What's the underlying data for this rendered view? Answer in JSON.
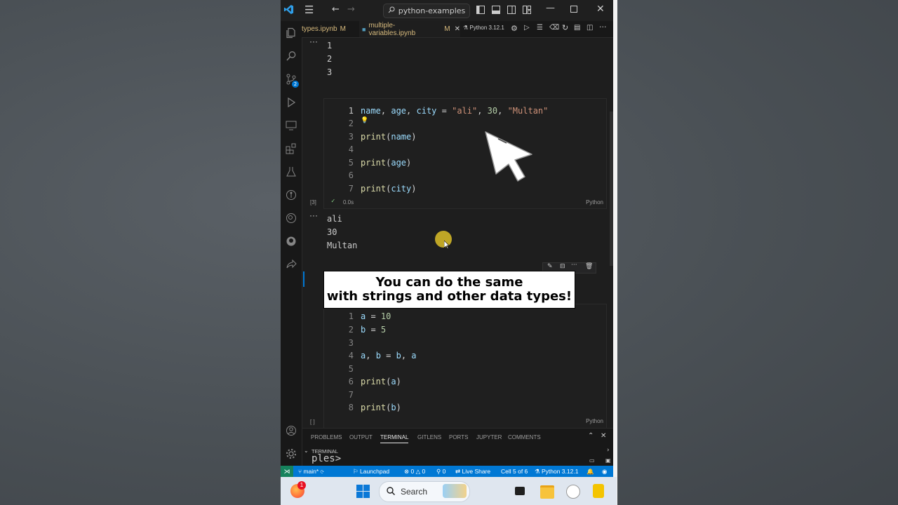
{
  "window": {
    "search_text": "python-examples"
  },
  "tabs": [
    {
      "label": "types.ipynb",
      "modified": "M"
    },
    {
      "label": "multiple-variables.ipynb",
      "modified": "M",
      "close": "✕"
    }
  ],
  "kernel": {
    "label": "Python 3.12.1"
  },
  "activity_bar": {
    "scm_badge": "2"
  },
  "output1": {
    "lines": [
      "1",
      "2",
      "3"
    ]
  },
  "cell1": {
    "line_numbers": [
      "1",
      "2",
      "3",
      "4",
      "5",
      "6",
      "7"
    ],
    "exec_count": "[3]",
    "exec_time": "0.0s",
    "language": "Python"
  },
  "output2": {
    "lines": [
      "ali",
      "30",
      "Multan"
    ]
  },
  "cell2": {
    "line_numbers": [
      "1",
      "2",
      "3",
      "4",
      "5",
      "6",
      "7",
      "8"
    ],
    "exec_count": "[ ]",
    "language": "Python"
  },
  "overlay_caption": {
    "line1": "You can do the same",
    "line2": "with strings and other data types!"
  },
  "panel": {
    "tabs": [
      "PROBLEMS",
      "OUTPUT",
      "TERMINAL",
      "GITLENS",
      "PORTS",
      "JUPYTER",
      "COMMENTS"
    ],
    "section": "TERMINAL",
    "terminal_text": "ples>"
  },
  "statusbar": {
    "branch": "main*",
    "launchpad": "Launchpad",
    "errors": "0",
    "warnings": "0",
    "ports": "0",
    "live_share": "Live Share",
    "cell": "Cell 5 of 6",
    "python": "Python 3.12.1"
  },
  "taskbar": {
    "search_label": "Search",
    "notif_badge": "1"
  },
  "colors": {
    "accent": "#0078d4",
    "editor_bg": "#1e1e1e",
    "modified_tab": "#d7ba7d"
  }
}
